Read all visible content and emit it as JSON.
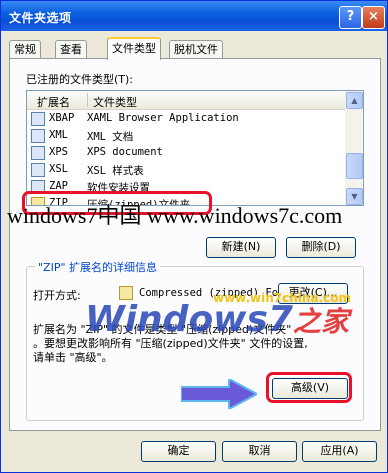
{
  "window": {
    "title": "文件夹选项",
    "help": "?",
    "close": "×"
  },
  "tabs": [
    {
      "label": "常规"
    },
    {
      "label": "查看"
    },
    {
      "label": "文件类型"
    },
    {
      "label": "脱机文件"
    }
  ],
  "registered_label": "已注册的文件类型(T):",
  "list": {
    "col_ext": "扩展名",
    "col_type": "文件类型",
    "rows": [
      {
        "ext": "XBAP",
        "type": "XAML Browser Application"
      },
      {
        "ext": "XML",
        "type": "XML 文档"
      },
      {
        "ext": "XPS",
        "type": "XPS document"
      },
      {
        "ext": "XSL",
        "type": "XSL 样式表"
      },
      {
        "ext": "ZAP",
        "type": "软件安装设置"
      },
      {
        "ext": "ZIP",
        "type": "压缩(zipped)文件夹"
      }
    ]
  },
  "buttons": {
    "new": "新建(N)",
    "delete": "删除(D)",
    "change": "更改(C)...",
    "advanced": "高级(V)",
    "ok": "确定",
    "cancel": "取消",
    "apply": "应用(A)"
  },
  "details": {
    "group_title": "\"ZIP\" 扩展名的详细信息",
    "opens_with_label": "打开方式:",
    "opens_with_value": "Compressed (zipped) Fo",
    "desc_line1": "扩展名为 \"ZIP\" 的文件是类型 \"压缩(zipped)文件夹\"",
    "desc_line2": "。要想更改影响所有 \"压缩(zipped)文件夹\" 文件的设置,",
    "desc_line3": "请单击 \"高级\"。"
  },
  "watermarks": {
    "line1": "windows7中国 www.windows7c.com",
    "site": "www.win7china.com",
    "logo_a": "Windows7",
    "logo_b": "之家"
  },
  "colors": {
    "highlight": "#e8102a",
    "arrow": "#6a5ad8",
    "title_blue": "#0a5fe0"
  }
}
